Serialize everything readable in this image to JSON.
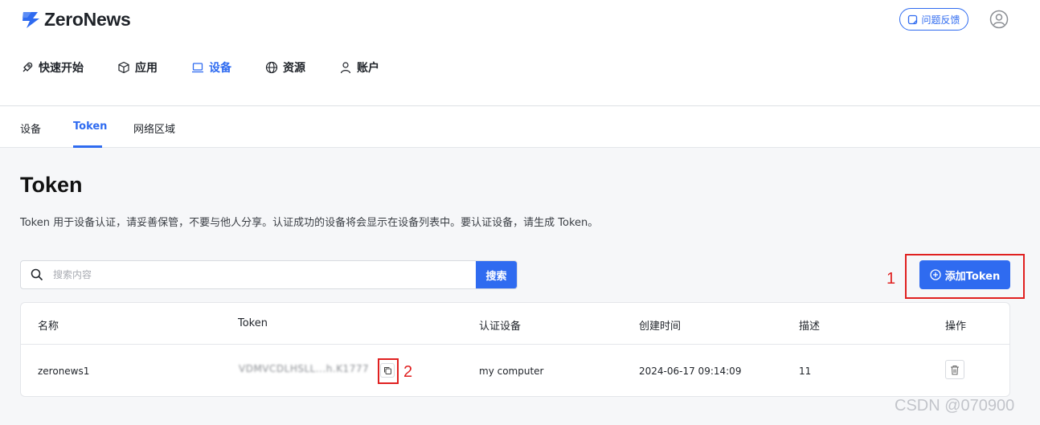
{
  "brand": {
    "name": "ZeroNews",
    "accent": "#2f6bf0"
  },
  "header": {
    "feedback_label": "问题反馈"
  },
  "nav": {
    "items": [
      {
        "label": "快速开始",
        "icon": "rocket-icon"
      },
      {
        "label": "应用",
        "icon": "cube-icon"
      },
      {
        "label": "设备",
        "icon": "laptop-icon",
        "active": true
      },
      {
        "label": "资源",
        "icon": "globe-icon"
      },
      {
        "label": "账户",
        "icon": "user-icon"
      }
    ]
  },
  "tabs": [
    {
      "label": "设备"
    },
    {
      "label": "Token",
      "active": true
    },
    {
      "label": "网络区域"
    }
  ],
  "page": {
    "title": "Token",
    "description": "Token 用于设备认证，请妥善保管，不要与他人分享。认证成功的设备将会显示在设备列表中。要认证设备，请生成 Token。"
  },
  "search": {
    "placeholder": "搜索内容",
    "button_label": "搜索"
  },
  "add_button": {
    "label": "添加Token"
  },
  "annotations": {
    "one": "1",
    "two": "2"
  },
  "table": {
    "headers": [
      "名称",
      "Token",
      "认证设备",
      "创建时间",
      "描述",
      "操作"
    ],
    "rows": [
      {
        "name": "zeronews1",
        "token": "VDMVCDLHSLL...h.K1777",
        "device": "my computer",
        "created": "2024-06-17 09:14:09",
        "description": "11"
      }
    ]
  },
  "watermark": "CSDN @070900"
}
